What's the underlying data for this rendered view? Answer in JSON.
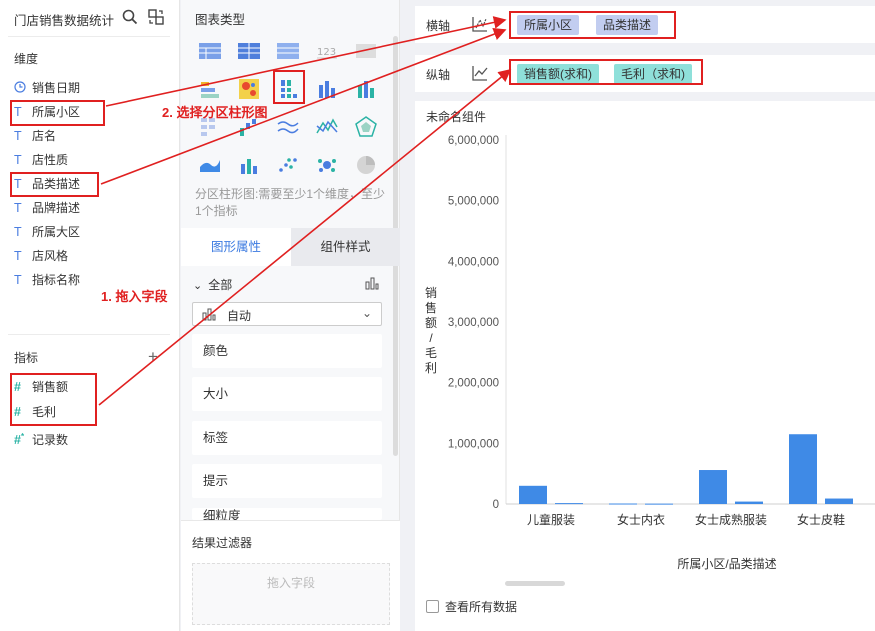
{
  "dataset": {
    "title": "门店销售数据统计",
    "dimensions_title": "维度",
    "dimensions": [
      {
        "label": "销售日期",
        "icon": "clock-icon"
      },
      {
        "label": "所属小区",
        "icon": "text-field-icon"
      },
      {
        "label": "店名",
        "icon": "text-field-icon"
      },
      {
        "label": "店性质",
        "icon": "text-field-icon"
      },
      {
        "label": "品类描述",
        "icon": "text-field-icon"
      },
      {
        "label": "品牌描述",
        "icon": "text-field-icon"
      },
      {
        "label": "所属大区",
        "icon": "text-field-icon"
      },
      {
        "label": "店风格",
        "icon": "text-field-icon"
      },
      {
        "label": "指标名称",
        "icon": "text-field-icon"
      }
    ],
    "measures_title": "指标",
    "measures": [
      {
        "label": "销售额",
        "icon": "number-field-icon"
      },
      {
        "label": "毛利",
        "icon": "number-field-icon"
      },
      {
        "label": "记录数",
        "icon": "number-field-icon"
      }
    ]
  },
  "chart_types": {
    "title": "图表类型",
    "description": "分区柱形图:需要至少1个维度，至少1个指标",
    "selected": "grouped-bar-chart-icon"
  },
  "tabs": {
    "shape": "图形属性",
    "style": "组件样式",
    "active": "shape"
  },
  "properties": {
    "all_label": "全部",
    "auto_label": "自动",
    "rows": [
      "颜色",
      "大小",
      "标签",
      "提示",
      "细粒度"
    ]
  },
  "filter": {
    "title": "结果过滤器",
    "placeholder": "拖入字段"
  },
  "axes": {
    "x_label": "横轴",
    "y_label": "纵轴",
    "x_fields": [
      "所属小区",
      "品类描述"
    ],
    "y_fields": [
      "销售额(求和)",
      "毛利（求和)"
    ]
  },
  "component_title": "未命名组件",
  "view_all_label": "查看所有数据",
  "annotations": {
    "step1": "1. 拖入字段",
    "step2": "2. 选择分区柱形图"
  },
  "colors": {
    "accent": "#3b7ae0",
    "bar": "#3f8ae6",
    "annotation": "#e02020",
    "dimension_pill": "#c2cdf0",
    "measure_pill": "#8fe0da"
  },
  "chart_data": {
    "type": "bar",
    "categories": [
      "儿童服装",
      "女士内衣",
      "女士成熟服装",
      "女士皮鞋"
    ],
    "series": [
      {
        "values": [
          300000,
          8000,
          560000,
          1150000
        ]
      },
      {
        "values": [
          15000,
          6000,
          40000,
          90000
        ]
      }
    ],
    "ylim": [
      0,
      6000000
    ],
    "y_ticks": [
      "0",
      "1,000,000",
      "2,000,000",
      "3,000,000",
      "4,000,000",
      "5,000,000",
      "6,000,000"
    ],
    "xlabel": "所属小区/品类描述",
    "ylabel": "销售额/毛利",
    "grid": false
  }
}
